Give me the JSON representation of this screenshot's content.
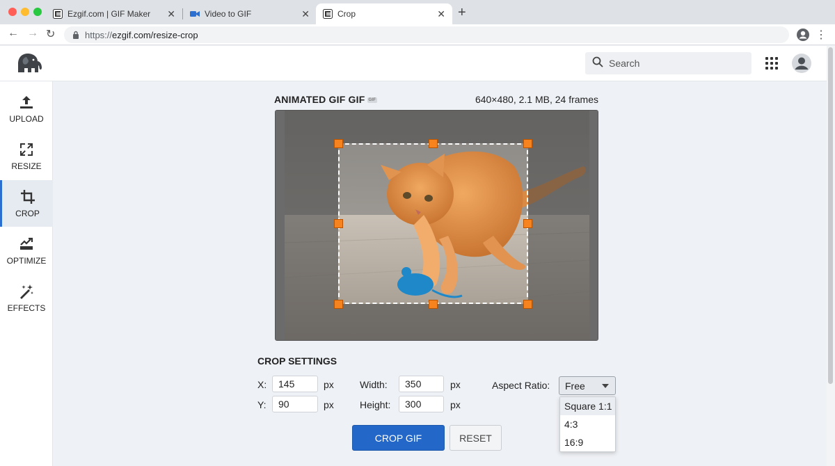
{
  "browser": {
    "tabs": [
      {
        "title": "Ezgif.com | GIF Maker",
        "active": false
      },
      {
        "title": "Video to GIF",
        "active": false
      },
      {
        "title": "Crop",
        "active": true
      }
    ],
    "url_protocol": "https://",
    "url_host": "ezgif.com/resize-crop"
  },
  "header": {
    "logo_icon": "elephant-logo-icon",
    "search_placeholder": "Search"
  },
  "sidebar": {
    "items": [
      {
        "label": "UPLOAD",
        "icon": "upload-icon"
      },
      {
        "label": "RESIZE",
        "icon": "resize-icon"
      },
      {
        "label": "CROP",
        "icon": "crop-icon",
        "active": true
      },
      {
        "label": "OPTIMIZE",
        "icon": "optimize-icon"
      },
      {
        "label": "EFFECTS",
        "icon": "effects-icon"
      }
    ]
  },
  "preview": {
    "title": "ANIMATED GIF GIF",
    "badge": "GIF",
    "meta": "640×480, 2.1 MB, 24 frames"
  },
  "crop_settings": {
    "title": "CROP SETTINGS",
    "x_label": "X:",
    "x_value": "145",
    "y_label": "Y:",
    "y_value": "90",
    "width_label": "Width:",
    "width_value": "350",
    "height_label": "Height:",
    "height_value": "300",
    "unit": "px",
    "aspect_label": "Aspect Ratio:",
    "aspect_value": "Free",
    "aspect_options": [
      "Square 1:1",
      "4:3",
      "16:9"
    ]
  },
  "actions": {
    "crop_label": "CROP GIF",
    "reset_label": "RESET"
  },
  "colors": {
    "accent": "#2368c9",
    "handle": "#f7831e"
  }
}
